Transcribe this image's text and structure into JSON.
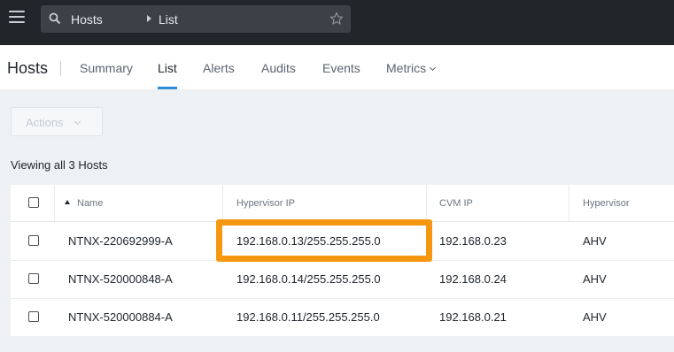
{
  "topbar": {
    "breadcrumb": [
      "Hosts",
      "List"
    ]
  },
  "nav": {
    "title": "Hosts",
    "tabs": [
      "Summary",
      "List",
      "Alerts",
      "Audits",
      "Events",
      "Metrics"
    ],
    "active_tab": "List"
  },
  "toolbar": {
    "actions_label": "Actions"
  },
  "summary": {
    "viewing_text": "Viewing all 3 Hosts"
  },
  "table": {
    "columns": [
      "Name",
      "Hypervisor IP",
      "CVM IP",
      "Hypervisor"
    ],
    "sort_column": "Name",
    "rows": [
      {
        "name": "NTNX-220692999-A",
        "hypervisor_ip": "192.168.0.13/255.255.255.0",
        "cvm_ip": "192.168.0.23",
        "hypervisor": "AHV"
      },
      {
        "name": "NTNX-520000848-A",
        "hypervisor_ip": "192.168.0.14/255.255.255.0",
        "cvm_ip": "192.168.0.24",
        "hypervisor": "AHV"
      },
      {
        "name": "NTNX-520000884-A",
        "hypervisor_ip": "192.168.0.11/255.255.255.0",
        "cvm_ip": "192.168.0.21",
        "hypervisor": "AHV"
      }
    ]
  },
  "annotation": {
    "highlighted_cell": "table.rows.0.hypervisor_ip",
    "color": "#f5980f"
  },
  "colors": {
    "topbar_bg": "#22262b",
    "accent_tab": "#2a8fd6",
    "highlight": "#f5980f"
  },
  "icons": {
    "menu": "hamburger-menu-icon",
    "search": "search-icon",
    "favorite": "star-icon",
    "breadcrumb_separator": "caret-right-icon",
    "dropdown": "chevron-down-icon",
    "sort": "sort-ascending-icon"
  }
}
